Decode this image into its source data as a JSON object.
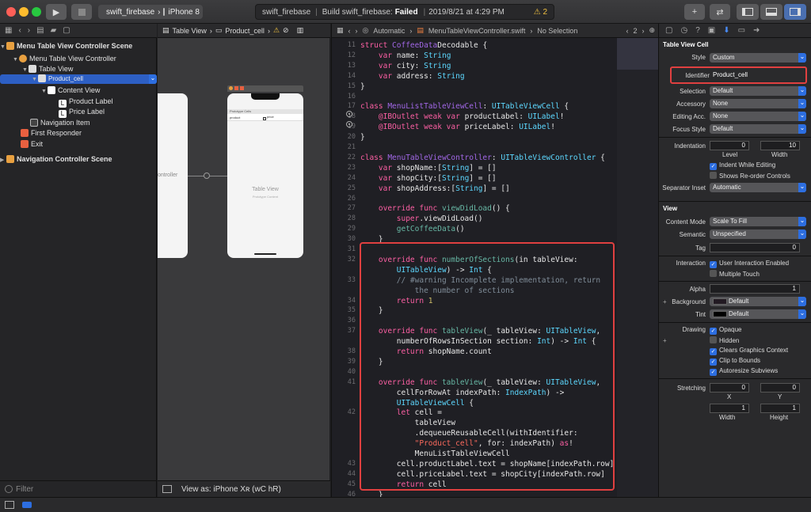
{
  "toolbar": {
    "scheme": "swift_firebase",
    "device": "iPhone 8",
    "status_project": "swift_firebase",
    "status_build": "Build swift_firebase:",
    "status_result": "Failed",
    "status_time": "2019/8/21 at 4:29 PM",
    "warnings": "2"
  },
  "navigator": {
    "rows": [
      {
        "label": "Menu Table View Controller Scene",
        "bold": true
      },
      {
        "label": "Menu Table View Controller"
      },
      {
        "label": "Table View"
      },
      {
        "label": "Product_cell",
        "selected": true
      },
      {
        "label": "Content View"
      },
      {
        "label": "Product Label"
      },
      {
        "label": "Price Label"
      },
      {
        "label": "Navigation Item"
      },
      {
        "label": "First Responder"
      },
      {
        "label": "Exit"
      },
      {
        "label": "Navigation Controller Scene",
        "bold": true
      }
    ],
    "filter_placeholder": "Filter"
  },
  "canvas": {
    "jump_table_view": "Table View",
    "jump_product_cell": "Product_cell",
    "controller_label": "ontroller",
    "prototype_header": "Prototype Cells",
    "cell_product": "product",
    "cell_price": "price",
    "table_view_label": "Table View",
    "prototype_content": "Prototype Content",
    "view_as": "View as: iPhone Xʀ (wC hR)"
  },
  "editor": {
    "mode": "Automatic",
    "file": "MenuTableViewController.swift",
    "selection": "No Selection",
    "counter": "2",
    "lines": [
      {
        "n": "11",
        "code": [
          [
            "k",
            "struct "
          ],
          [
            "p",
            "CoffeeData"
          ],
          [
            "",
            "Decodable {"
          ]
        ]
      },
      {
        "n": "12",
        "code": [
          [
            "k",
            "    var "
          ],
          [
            "",
            "name: "
          ],
          [
            "t",
            "String"
          ]
        ]
      },
      {
        "n": "13",
        "code": [
          [
            "k",
            "    var "
          ],
          [
            "",
            "city: "
          ],
          [
            "t",
            "String"
          ]
        ]
      },
      {
        "n": "14",
        "code": [
          [
            "k",
            "    var "
          ],
          [
            "",
            "address: "
          ],
          [
            "t",
            "String"
          ]
        ]
      },
      {
        "n": "15",
        "code": [
          [
            "",
            "}"
          ]
        ]
      },
      {
        "n": "16",
        "code": []
      },
      {
        "n": "17",
        "code": [
          [
            "k",
            "class "
          ],
          [
            "p",
            "MenuListTableViewCell"
          ],
          [
            "",
            ": "
          ],
          [
            "t",
            "UITableViewCell"
          ],
          [
            "",
            " {"
          ]
        ]
      },
      {
        "n": "18",
        "code": [
          [
            "k",
            "    @IBOutlet weak var "
          ],
          [
            "",
            "productLabel: "
          ],
          [
            "t",
            "UILabel"
          ],
          [
            "",
            "!"
          ]
        ]
      },
      {
        "n": "19",
        "code": [
          [
            "k",
            "    @IBOutlet weak var "
          ],
          [
            "",
            "priceLabel: "
          ],
          [
            "t",
            "UILabel"
          ],
          [
            "",
            "!"
          ]
        ]
      },
      {
        "n": "20",
        "code": [
          [
            "",
            "}"
          ]
        ]
      },
      {
        "n": "21",
        "code": []
      },
      {
        "n": "22",
        "code": [
          [
            "k",
            "class "
          ],
          [
            "p",
            "MenuTableViewController"
          ],
          [
            "",
            ": "
          ],
          [
            "t",
            "UITableViewController"
          ],
          [
            "",
            " {"
          ]
        ]
      },
      {
        "n": "23",
        "code": [
          [
            "k",
            "    var "
          ],
          [
            "",
            "shopName:["
          ],
          [
            "t",
            "String"
          ],
          [
            "",
            "] = []"
          ]
        ]
      },
      {
        "n": "24",
        "code": [
          [
            "k",
            "    var "
          ],
          [
            "",
            "shopCity:["
          ],
          [
            "t",
            "String"
          ],
          [
            "",
            "] = []"
          ]
        ]
      },
      {
        "n": "25",
        "code": [
          [
            "k",
            "    var "
          ],
          [
            "",
            "shopAddress:["
          ],
          [
            "t",
            "String"
          ],
          [
            "",
            "] = []"
          ]
        ]
      },
      {
        "n": "26",
        "code": []
      },
      {
        "n": "27",
        "code": [
          [
            "k",
            "    override func "
          ],
          [
            "f",
            "viewDidLoad"
          ],
          [
            "",
            "() {"
          ]
        ]
      },
      {
        "n": "28",
        "code": [
          [
            "k",
            "        super"
          ],
          [
            "",
            ".viewDidLoad()"
          ]
        ]
      },
      {
        "n": "29",
        "code": [
          [
            "f",
            "        getCoffeeData"
          ],
          [
            "",
            "()"
          ]
        ]
      },
      {
        "n": "30",
        "code": [
          [
            "",
            "    }"
          ]
        ]
      },
      {
        "n": "31",
        "code": []
      },
      {
        "n": "32",
        "code": [
          [
            "k",
            "    override func "
          ],
          [
            "f",
            "numberOfSections"
          ],
          [
            "",
            "(in tableView:"
          ]
        ]
      },
      {
        "n": "",
        "code": [
          [
            "t",
            "        UITableView"
          ],
          [
            "",
            ") -> "
          ],
          [
            "t",
            "Int"
          ],
          [
            "",
            " {"
          ]
        ]
      },
      {
        "n": "33",
        "code": [
          [
            "c",
            "        // #warning Incomplete implementation, return"
          ]
        ]
      },
      {
        "n": "",
        "code": [
          [
            "c",
            "            the number of sections"
          ]
        ]
      },
      {
        "n": "34",
        "code": [
          [
            "k",
            "        return "
          ],
          [
            "n",
            "1"
          ]
        ]
      },
      {
        "n": "35",
        "code": [
          [
            "",
            "    }"
          ]
        ]
      },
      {
        "n": "36",
        "code": []
      },
      {
        "n": "37",
        "code": [
          [
            "k",
            "    override func "
          ],
          [
            "f",
            "tableView"
          ],
          [
            "",
            "(_ tableView: "
          ],
          [
            "t",
            "UITableView"
          ],
          [
            "",
            ","
          ]
        ]
      },
      {
        "n": "",
        "code": [
          [
            "",
            "        numberOfRowsInSection section: "
          ],
          [
            "t",
            "Int"
          ],
          [
            "",
            ") -> "
          ],
          [
            "t",
            "Int"
          ],
          [
            "",
            " {"
          ]
        ]
      },
      {
        "n": "38",
        "code": [
          [
            "k",
            "        return "
          ],
          [
            "",
            "shopName.count"
          ]
        ]
      },
      {
        "n": "39",
        "code": [
          [
            "",
            "    }"
          ]
        ]
      },
      {
        "n": "40",
        "code": []
      },
      {
        "n": "41",
        "code": [
          [
            "k",
            "    override func "
          ],
          [
            "f",
            "tableView"
          ],
          [
            "",
            "(_ tableView: "
          ],
          [
            "t",
            "UITableView"
          ],
          [
            "",
            ","
          ]
        ]
      },
      {
        "n": "",
        "code": [
          [
            "",
            "        cellForRowAt indexPath: "
          ],
          [
            "t",
            "IndexPath"
          ],
          [
            "",
            ") ->"
          ]
        ]
      },
      {
        "n": "",
        "code": [
          [
            "t",
            "        UITableViewCell"
          ],
          [
            "",
            " {"
          ]
        ]
      },
      {
        "n": "42",
        "code": [
          [
            "k",
            "        let "
          ],
          [
            "",
            "cell ="
          ]
        ]
      },
      {
        "n": "",
        "code": [
          [
            "",
            "            tableView"
          ]
        ]
      },
      {
        "n": "",
        "code": [
          [
            "",
            "            .dequeueReusableCell(withIdentifier:"
          ]
        ]
      },
      {
        "n": "",
        "code": [
          [
            "s",
            "            \"Product_cell\""
          ],
          [
            "",
            ", for: indexPath) "
          ],
          [
            "k",
            "as"
          ],
          [
            "",
            "!"
          ]
        ]
      },
      {
        "n": "",
        "code": [
          [
            "",
            "            MenuListTableViewCell"
          ]
        ]
      },
      {
        "n": "43",
        "code": [
          [
            "",
            "        cell.productLabel.text = shopName[indexPath.row]"
          ]
        ]
      },
      {
        "n": "44",
        "code": [
          [
            "",
            "        cell.priceLabel.text = shopCity[indexPath.row]"
          ]
        ]
      },
      {
        "n": "45",
        "code": [
          [
            "k",
            "        return "
          ],
          [
            "",
            "cell"
          ]
        ]
      },
      {
        "n": "46",
        "code": [
          [
            "",
            "    }"
          ]
        ]
      },
      {
        "n": "47",
        "code": []
      }
    ]
  },
  "inspector": {
    "section_cell": "Table View Cell",
    "style_label": "Style",
    "style_value": "Custom",
    "identifier_label": "Identifier",
    "identifier_value": "Product_cell",
    "selection_label": "Selection",
    "selection_value": "Default",
    "accessory_label": "Accessory",
    "accessory_value": "None",
    "editing_label": "Editing Acc.",
    "editing_value": "None",
    "focus_label": "Focus Style",
    "focus_value": "Default",
    "indentation_label": "Indentation",
    "level_value": "0",
    "width_value": "10",
    "level_caption": "Level",
    "width_caption": "Width",
    "indent_editing": "Indent While Editing",
    "reorder": "Shows Re-order Controls",
    "separator_label": "Separator Inset",
    "separator_value": "Automatic",
    "section_view": "View",
    "content_mode_label": "Content Mode",
    "content_mode_value": "Scale To Fill",
    "semantic_label": "Semantic",
    "semantic_value": "Unspecified",
    "tag_label": "Tag",
    "tag_value": "0",
    "interaction_label": "Interaction",
    "user_interaction": "User Interaction Enabled",
    "multiple_touch": "Multiple Touch",
    "alpha_label": "Alpha",
    "alpha_value": "1",
    "background_label": "Background",
    "background_value": "Default",
    "tint_label": "Tint",
    "tint_value": "Default",
    "drawing_label": "Drawing",
    "opaque": "Opaque",
    "hidden": "Hidden",
    "clears": "Clears Graphics Context",
    "clip": "Clip to Bounds",
    "autoresize": "Autoresize Subviews",
    "stretching_label": "Stretching",
    "sx": "0",
    "sy": "0",
    "sw": "1",
    "sh": "1",
    "x_caption": "X",
    "y_caption": "Y",
    "w_caption": "Width",
    "h_caption": "Height"
  },
  "colors": {
    "accent": "#2d6ee0",
    "highlight": "#e04040",
    "selection": "#2d5fc4"
  }
}
